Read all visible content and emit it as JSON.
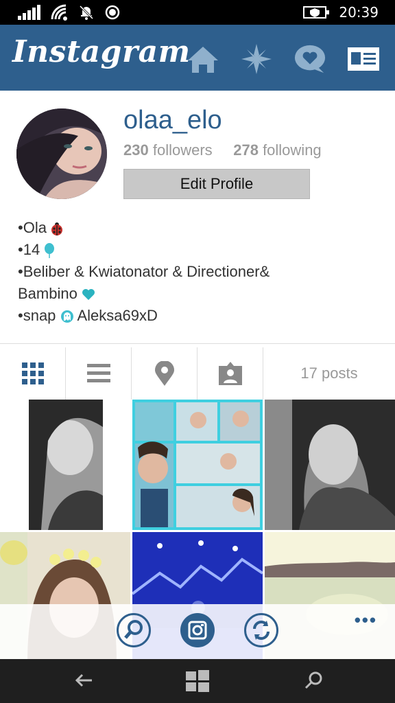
{
  "status_bar": {
    "time": "20:39",
    "icons": [
      "signal-icon",
      "wifi-icon",
      "quiet-hours-icon",
      "location-icon",
      "battery-saver-icon"
    ]
  },
  "app_bar": {
    "logo": "Instagram",
    "nav_icons": [
      "home-icon",
      "explore-icon",
      "activity-icon",
      "profile-icon"
    ]
  },
  "profile": {
    "username": "olaa_elo",
    "followers_count": "230",
    "followers_label": "followers",
    "following_count": "278",
    "following_label": "following",
    "edit_button": "Edit Profile",
    "bio": {
      "line1": "•Ola",
      "line2": "•14",
      "line3": "•Beliber & Kwiatonator & Directioner&",
      "line4": "Bambino",
      "line5_prefix": "•snap",
      "line5_suffix": " Aleksa69xD"
    }
  },
  "tabs": {
    "icons": [
      "grid-view-icon",
      "list-view-icon",
      "location-pin-icon",
      "tagged-photos-icon"
    ],
    "posts_label": "17 posts"
  },
  "bottom_bar": {
    "buttons": [
      "search-icon",
      "camera-icon",
      "refresh-icon"
    ],
    "more_label": "•••"
  },
  "colors": {
    "brand": "#2e5f8d",
    "accent_cyan": "#3fbfcf",
    "muted_text": "#999999"
  }
}
